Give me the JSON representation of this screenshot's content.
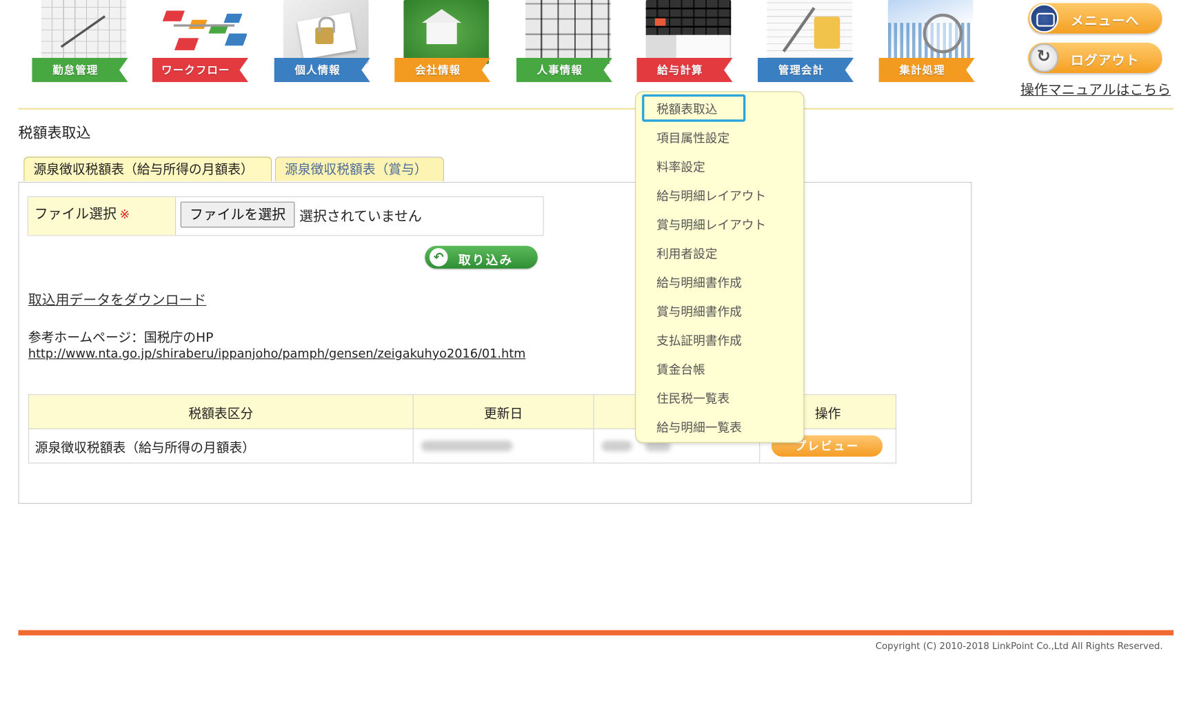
{
  "nav": [
    {
      "label": "勤怠管理",
      "color": "#47a741",
      "icon": "calendar-photo-icon"
    },
    {
      "label": "ワークフロー",
      "color": "#e23a3f",
      "icon": "workflow-blocks-icon"
    },
    {
      "label": "個人情報",
      "color": "#3a7fc2",
      "icon": "padlock-photo-icon"
    },
    {
      "label": "会社情報",
      "color": "#f39a21",
      "icon": "house-photo-icon"
    },
    {
      "label": "人事情報",
      "color": "#47a741",
      "icon": "file-cabinet-photo-icon"
    },
    {
      "label": "給与計算",
      "color": "#e23a3f",
      "icon": "calculator-photo-icon"
    },
    {
      "label": "管理会計",
      "color": "#3a7fc2",
      "icon": "accounting-sheet-photo-icon"
    },
    {
      "label": "集計処理",
      "color": "#f39a21",
      "icon": "magnifier-chart-photo-icon"
    }
  ],
  "header": {
    "menu_label": "メニューへ",
    "logout_label": "ログアウト",
    "manual_link": "操作マニュアルはこちら"
  },
  "page": {
    "title": "税額表取込",
    "tabs": [
      {
        "label": "源泉徴収税額表（給与所得の月額表）",
        "active": true
      },
      {
        "label": "源泉徴収税額表（賞与）",
        "active": false
      }
    ],
    "file_label": "ファイル選択",
    "required_mark": "※",
    "file_button": "ファイルを選択",
    "file_status": "選択されていません",
    "import_button": "取り込み",
    "download_link": "取込用データをダウンロード",
    "reference_text": "参考ホームページ：国税庁のHP",
    "reference_url": "http://www.nta.go.jp/shiraberu/ippanjoho/pamph/gensen/zeigakuhyo2016/01.htm"
  },
  "table": {
    "headers": [
      "税額表区分",
      "更新日",
      "",
      "操作"
    ],
    "rows": [
      {
        "category": "源泉徴収税額表（給与所得の月額表）",
        "action": "プレビュー"
      }
    ]
  },
  "dropdown": {
    "items": [
      "税額表取込",
      "項目属性設定",
      "料率設定",
      "給与明細レイアウト",
      "賞与明細レイアウト",
      "利用者設定",
      "給与明細書作成",
      "賞与明細書作成",
      "支払証明書作成",
      "賃金台帳",
      "住民税一覧表",
      "給与明細一覧表"
    ],
    "selected_index": 0
  },
  "footer": {
    "copyright": "Copyright (C) 2010-2018 LinkPoint Co.,Ltd All Rights Reserved."
  }
}
